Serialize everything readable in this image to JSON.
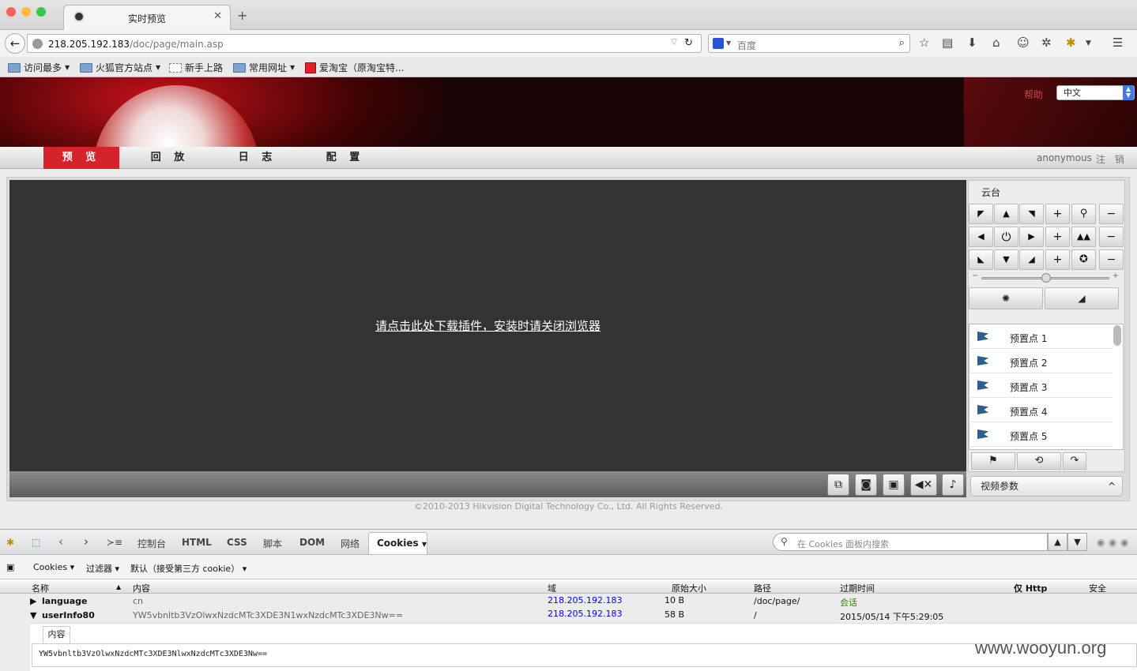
{
  "browser": {
    "tab_title": "实时预览",
    "url_host": "218.205.192.183",
    "url_path": "/doc/page/main.asp",
    "search_placeholder": "百度",
    "bookmarks": [
      "访问最多",
      "火狐官方站点",
      "新手上路",
      "常用网址",
      "爱淘宝（原淘宝特..."
    ]
  },
  "header": {
    "help": "帮助",
    "language": "中文",
    "menu": [
      "预 览",
      "回 放",
      "日 志",
      "配 置"
    ],
    "user": "anonymous",
    "logout": "注 销"
  },
  "video": {
    "plugin_link": "请点击此处下载插件，安装时请关闭浏览器"
  },
  "ptz": {
    "title": "云台",
    "presets": [
      "预置点 1",
      "预置点 2",
      "预置点 3",
      "预置点 4",
      "预置点 5"
    ],
    "video_params": "视频参数"
  },
  "footer": {
    "copyright": "©2010-2013 Hikvision Digital Technology Co., Ltd. All Rights Reserved."
  },
  "firebug": {
    "tabs": [
      "控制台",
      "HTML",
      "CSS",
      "脚本",
      "DOM",
      "网络"
    ],
    "active_tab": "Cookies",
    "search_placeholder": "在 Cookies 面板内搜索",
    "sub_menu": [
      "Cookies",
      "过滤器",
      "默认（接受第三方 cookie）"
    ],
    "columns": [
      "名称",
      "内容",
      "域",
      "原始大小",
      "路径",
      "过期时间",
      "仅 Http",
      "安全"
    ],
    "rows": [
      {
        "name": "language",
        "content": "cn",
        "domain": "218.205.192.183",
        "size": "10 B",
        "path": "/doc/page/",
        "expires": "会话"
      },
      {
        "name": "userInfo80",
        "content": "YW5vbnltb3VzOlwxNzdcMTc3XDE3N1wxNzdcMTc3XDE3Nw==",
        "domain": "218.205.192.183",
        "size": "58 B",
        "path": "/",
        "expires": "2015/05/14 下午5:29:05"
      }
    ],
    "detail_tab": "内容",
    "detail_value": "YW5vbnltb3VzOlwxNzdcMTc3XDE3NlwxNzdcMTc3XDE3Nw=="
  },
  "watermark": "www.wooyun.org"
}
